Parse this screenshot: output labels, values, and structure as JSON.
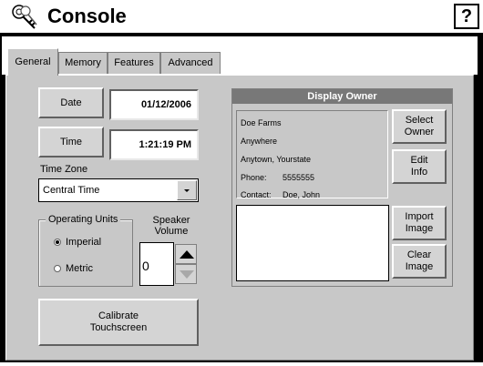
{
  "window": {
    "title": "Console",
    "help_label": "?"
  },
  "tabs": [
    {
      "label": "General",
      "active": true
    },
    {
      "label": "Memory",
      "active": false
    },
    {
      "label": "Features",
      "active": false
    },
    {
      "label": "Advanced",
      "active": false
    }
  ],
  "general": {
    "date_button": "Date",
    "date_value": "01/12/2006",
    "time_button": "Time",
    "time_value": "1:21:19 PM",
    "timezone_label": "Time Zone",
    "timezone_value": "Central Time",
    "operating_units": {
      "title": "Operating Units",
      "options": [
        "Imperial",
        "Metric"
      ],
      "selected": "Imperial"
    },
    "speaker": {
      "label": "Speaker\nVolume",
      "value": "0"
    },
    "calibrate_button": "Calibrate\nTouchscreen"
  },
  "owner": {
    "title": "Display Owner",
    "name": "Doe Farms",
    "address1": "Anywhere",
    "address2": "Anytown, Yourstate",
    "phone_label": "Phone:",
    "phone": "5555555",
    "contact_label": "Contact:",
    "contact": "Doe, John",
    "select_button": "Select\nOwner",
    "edit_button": "Edit\nInfo",
    "import_button": "Import\nImage",
    "clear_button": "Clear\nImage"
  },
  "icons": {
    "title_icon": "keys-icon",
    "dropdown": "chevron-down-icon",
    "spin_up": "arrow-up-icon",
    "spin_down": "arrow-down-icon"
  }
}
